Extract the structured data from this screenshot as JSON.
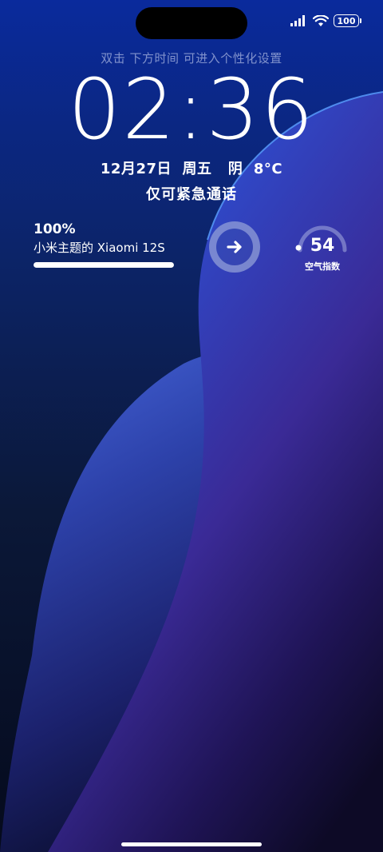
{
  "status_bar": {
    "battery_level": "100",
    "signal_icon": "signal-bars-icon",
    "wifi_icon": "wifi-icon"
  },
  "lock_screen": {
    "hint": "双击 下方时间 可进入个性化设置",
    "time": {
      "hours": "02",
      "separator": ":",
      "minutes": "36"
    },
    "date_line": "12月27日  周五   阴  8°C",
    "emergency_text": "仅可紧急通话"
  },
  "battery_widget": {
    "percent_label": "100%",
    "device_name": "小米主题的 Xiaomi 12S",
    "level": 1.0
  },
  "arrow_button": {
    "icon": "arrow-right-icon"
  },
  "air_quality": {
    "value": "54",
    "label": "空气指数"
  },
  "colors": {
    "wallpaper_top": "#0a2a9c",
    "wallpaper_bottom": "#050a1c",
    "wave_blue": "#1f4fd8",
    "wave_purple": "#2a1c6e"
  }
}
